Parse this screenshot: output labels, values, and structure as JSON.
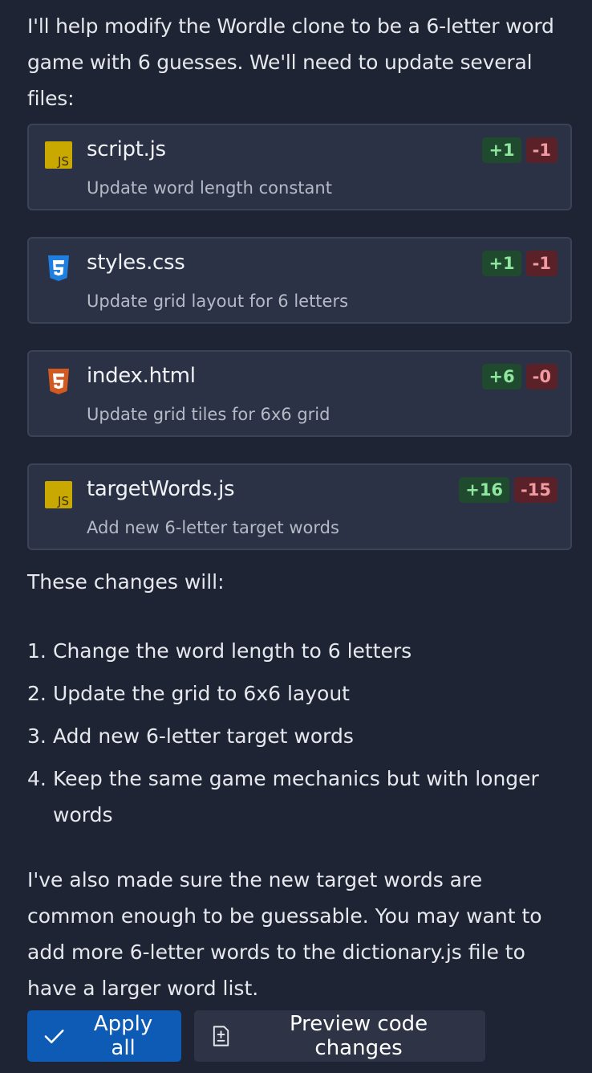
{
  "intro": "I'll help modify the Wordle clone to be a 6-letter word game with 6 guesses. We'll need to update several files:",
  "files": [
    {
      "name": "script.js",
      "desc": "Update word length constant",
      "added": "+1",
      "removed": "-1",
      "icon": "js-icon"
    },
    {
      "name": "styles.css",
      "desc": "Update grid layout for 6 letters",
      "added": "+1",
      "removed": "-1",
      "icon": "css3-icon"
    },
    {
      "name": "index.html",
      "desc": "Update grid tiles for 6x6 grid",
      "added": "+6",
      "removed": "-0",
      "icon": "html5-icon"
    },
    {
      "name": "targetWords.js",
      "desc": "Add new 6-letter target words",
      "added": "+16",
      "removed": "-15",
      "icon": "js-icon"
    }
  ],
  "changes_heading": "These changes will:",
  "steps": [
    {
      "num": "1.",
      "text": "Change the word length to 6 letters"
    },
    {
      "num": "2.",
      "text": "Update the grid to 6x6 layout"
    },
    {
      "num": "3.",
      "text": "Add new 6-letter target words"
    },
    {
      "num": "4.",
      "text": "Keep the same game mechanics but with longer words"
    }
  ],
  "outro": "I've also made sure the new target words are common enough to be guessable. You may want to add more 6-letter words to the dictionary.js file to have a larger word list.",
  "actions": {
    "apply_label": "Apply all",
    "preview_label": "Preview code changes"
  },
  "colors": {
    "background": "#1e2433",
    "card": "#2b3245",
    "primary_button": "#0d5bb5",
    "added": "#8ee69f",
    "removed": "#f19aa2"
  }
}
